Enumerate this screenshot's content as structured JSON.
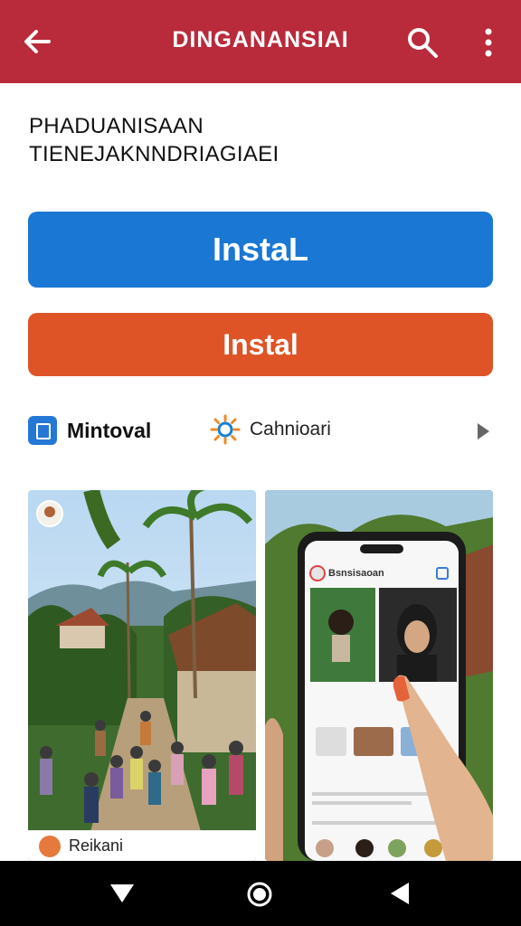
{
  "appbar": {
    "title": "DINGANANSIAI",
    "back_icon": "arrow-left-icon",
    "search_icon": "search-icon",
    "more_icon": "more-vert-icon",
    "color": "#b92a3a"
  },
  "header": {
    "line1": "PHADUANISAAN",
    "line2": "TIENEJAKNNDRIAGIAEI"
  },
  "buttons": {
    "primary_label": "InstaL",
    "primary_color": "#1a78d4",
    "secondary_label": "Instal",
    "secondary_color": "#de5427"
  },
  "tabs": [
    {
      "label": "Mintoval",
      "icon": "book-icon"
    },
    {
      "label": "Cahnioari",
      "icon": "sun-icon"
    }
  ],
  "tabs_next_icon": "chevron-right-icon",
  "cards": [
    {
      "caption": "Reikani",
      "image": "village-street-photo"
    },
    {
      "image": "phone-in-hand-photo",
      "phone_title": "Bsnsisaoan"
    }
  ],
  "navbar": {
    "back_icon": "triangle-back-icon",
    "home_icon": "circle-home-icon",
    "recents_icon": "triangle-recents-icon"
  }
}
